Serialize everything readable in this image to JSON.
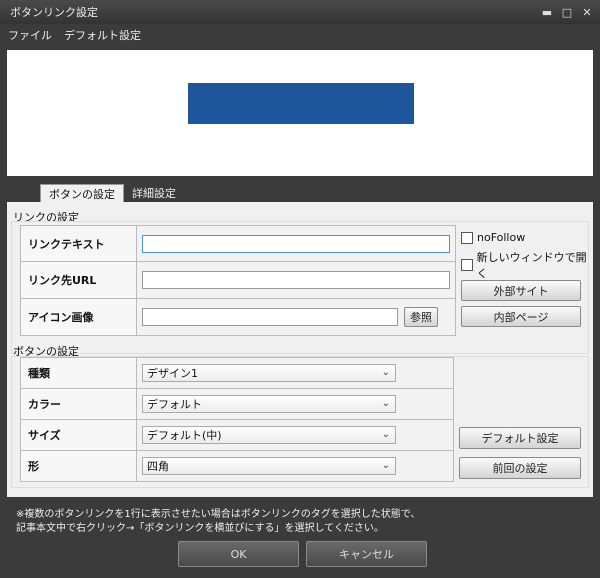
{
  "window": {
    "title": "ボタンリンク設定",
    "controls": {
      "minimize": "▬",
      "maximize": "□",
      "close": "✕"
    }
  },
  "menu": {
    "file": "ファイル",
    "default_settings": "デフォルト設定"
  },
  "preview": {
    "button_color": "#1e569c"
  },
  "tabs": {
    "button_settings": "ボタンの設定",
    "advanced": "詳細設定"
  },
  "link_group": {
    "label": "リンクの設定",
    "link_text_label": "リンクテキスト",
    "link_text_value": "",
    "link_url_label": "リンク先URL",
    "link_url_value": "",
    "icon_label": "アイコン画像",
    "icon_value": "",
    "browse": "参照",
    "nofollow": "noFollow",
    "new_window": "新しいウィンドウで開く",
    "external_site": "外部サイト",
    "internal_page": "内部ページ"
  },
  "button_group": {
    "label": "ボタンの設定",
    "type_label": "種類",
    "type_value": "デザイン1",
    "color_label": "カラー",
    "color_value": "デフォルト",
    "size_label": "サイズ",
    "size_value": "デフォルト(中)",
    "shape_label": "形",
    "shape_value": "四角",
    "default_settings": "デフォルト設定",
    "previous_settings": "前回の設定"
  },
  "footer": {
    "note_line1": "※複数のボタンリンクを1行に表示させたい場合はボタンリンクのタグを選択した状態で、",
    "note_line2": "記事本文中で右クリック→「ボタンリンクを横並びにする」を選択してください。",
    "ok": "OK",
    "cancel": "キャンセル"
  }
}
